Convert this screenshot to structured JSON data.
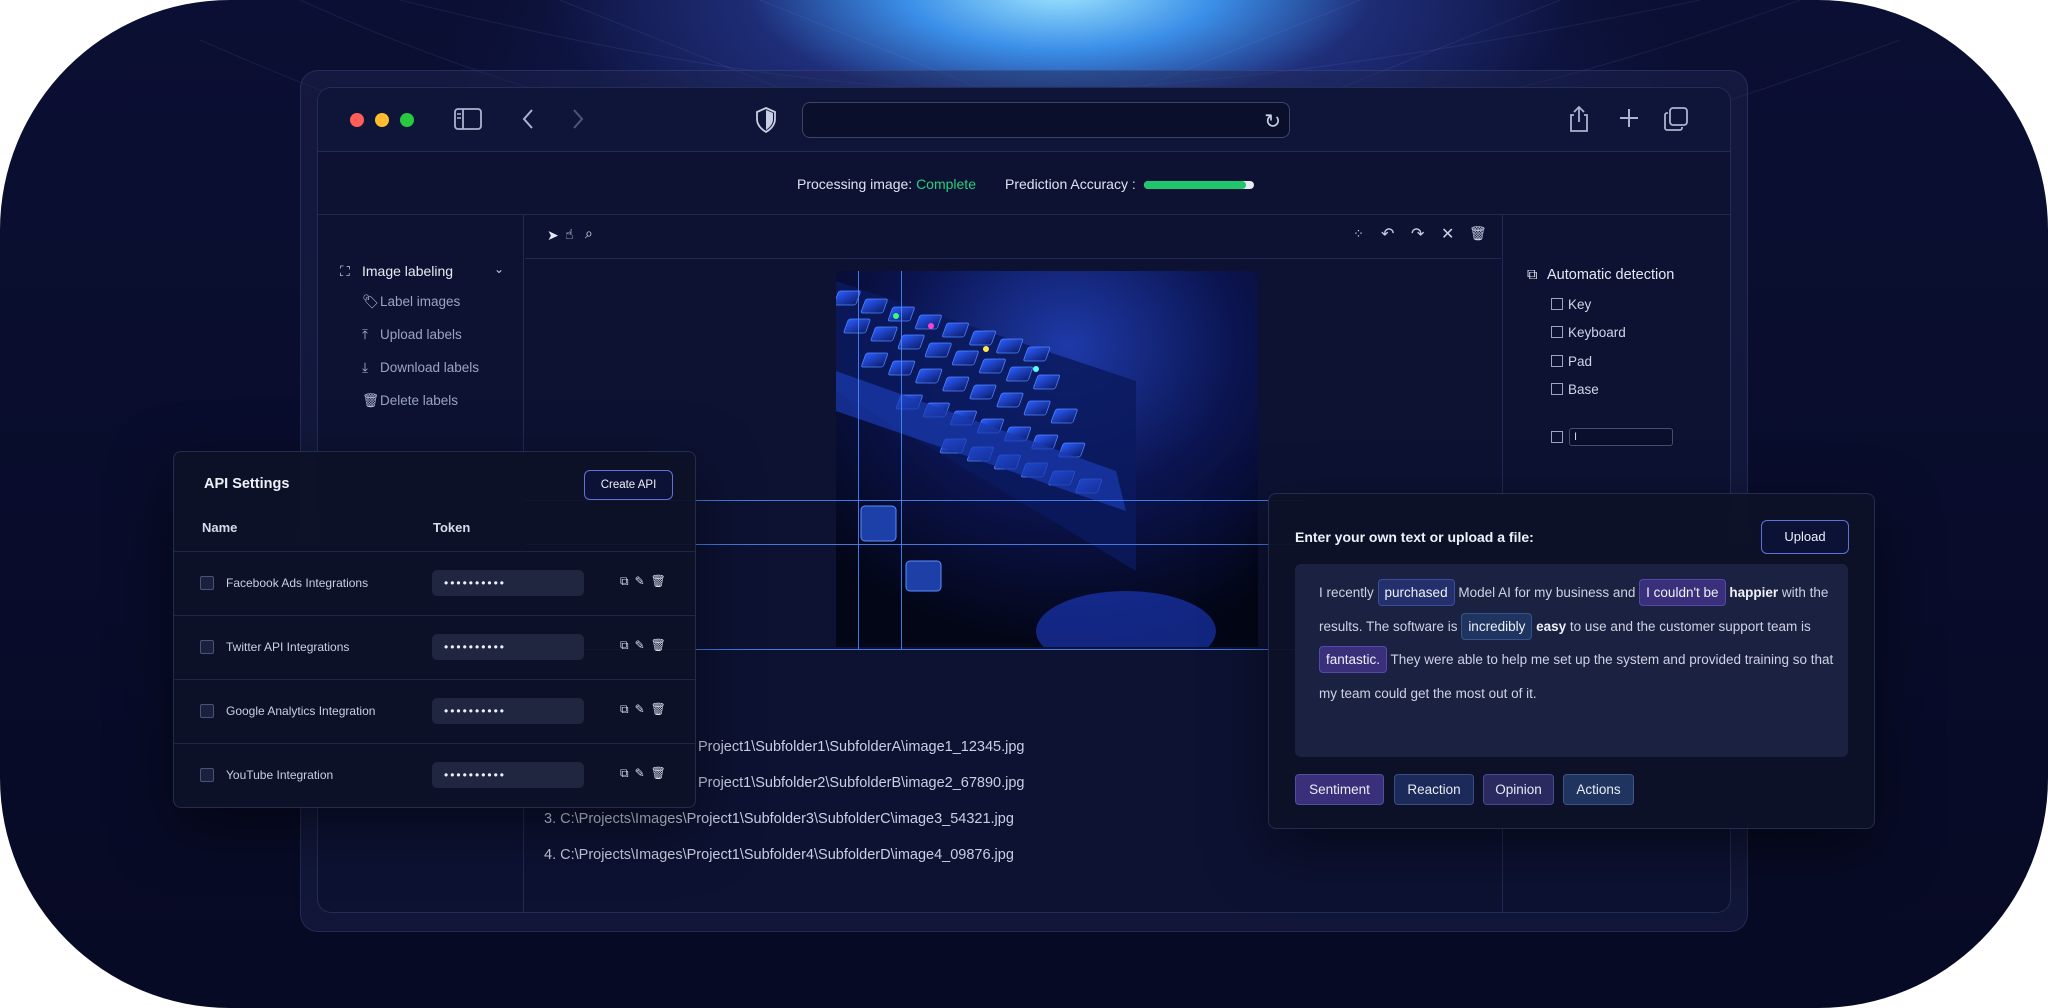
{
  "colors": {
    "accent": "#5f72d8",
    "complete": "#26d07c",
    "progress_fill": "#1fc66e",
    "window_bg": "#0d1233"
  },
  "browser": {
    "address_value": "",
    "icons": [
      "sidebar-icon",
      "back-icon",
      "forward-icon",
      "shield-icon",
      "reload-icon",
      "share-icon",
      "new-tab-icon",
      "tabs-icon"
    ]
  },
  "status": {
    "processing_label": "Processing image:",
    "processing_value": "Complete",
    "accuracy_label": "Prediction Accuracy :",
    "accuracy_fraction": 0.93
  },
  "sidebar": {
    "heading": "Image labeling",
    "items": [
      {
        "label": "Label images",
        "icon": "tag-icon"
      },
      {
        "label": "Upload labels",
        "icon": "upload-icon"
      },
      {
        "label": "Download labels",
        "icon": "download-icon"
      },
      {
        "label": "Delete labels",
        "icon": "trash-icon"
      }
    ]
  },
  "toolbar": {
    "left_icons": [
      "pointer-icon",
      "hand-icon",
      "zoom-icon"
    ],
    "right_icons": [
      "grid-icon",
      "undo-icon",
      "redo-icon",
      "close-icon",
      "delete-icon"
    ]
  },
  "detection": {
    "heading": "Automatic detection",
    "items": [
      "Key",
      "Keyboard",
      "Pad",
      "Base"
    ],
    "input_value": "I"
  },
  "files": [
    "Project1\\Subfolder1\\SubfolderA\\image1_12345.jpg",
    "Project1\\Subfolder2\\SubfolderB\\image2_67890.jpg",
    "3. C:\\Projects\\Images\\Project1\\Subfolder3\\SubfolderC\\image3_54321.jpg",
    "4. C:\\Projects\\Images\\Project1\\Subfolder4\\SubfolderD\\image4_09876.jpg"
  ],
  "api": {
    "title": "API Settings",
    "create_button": "Create API",
    "columns": [
      "Name",
      "Token"
    ],
    "rows": [
      {
        "name": "Facebook Ads Integrations",
        "token": "••••••••••"
      },
      {
        "name": "Twitter API Integrations",
        "token": "••••••••••"
      },
      {
        "name": "Google Analytics Integration",
        "token": "••••••••••"
      },
      {
        "name": "YouTube Integration",
        "token": "••••••••••"
      }
    ]
  },
  "text_panel": {
    "heading": "Enter your own text or upload a file:",
    "upload_button": "Upload",
    "segments": [
      {
        "t": "I recently "
      },
      {
        "t": "purchased",
        "hl": "blue"
      },
      {
        "t": " Model AI for my business and "
      },
      {
        "t": "I couldn't be",
        "hl": "purple"
      },
      {
        "t": " "
      },
      {
        "t": "happier",
        "bold": true
      },
      {
        "t": " with the results. The software is "
      },
      {
        "t": "incredibly",
        "hl": "teal"
      },
      {
        "t": " "
      },
      {
        "t": "easy",
        "bold": true
      },
      {
        "t": " to use and the customer support team is "
      },
      {
        "t": "fantastic.",
        "hl": "purple"
      },
      {
        "t": " They were able to help me set up the system and provided training so that my team could get the most out of it."
      }
    ],
    "tags": [
      {
        "label": "Sentiment",
        "color": "#3a2f7a"
      },
      {
        "label": "Reaction",
        "color": "#1c2a5a"
      },
      {
        "label": "Opinion",
        "color": "#2a2a60"
      },
      {
        "label": "Actions",
        "color": "#1f3560"
      }
    ]
  }
}
